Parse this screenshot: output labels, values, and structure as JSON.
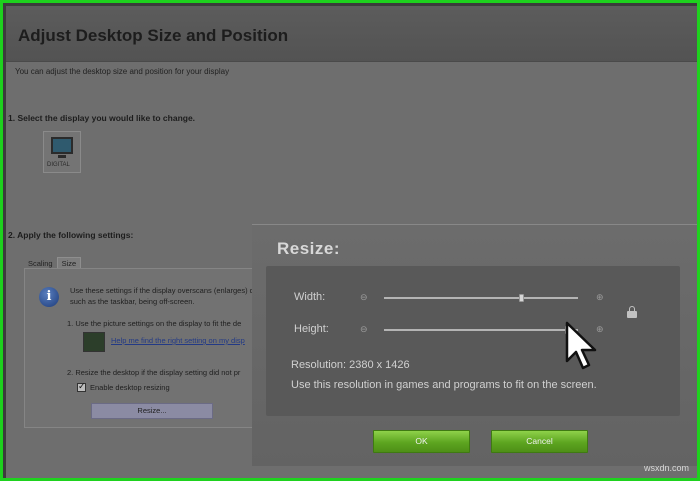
{
  "background_panel": {
    "title": "Adjust Desktop Size and Position",
    "subtitle": "You can adjust the desktop size and position for your display",
    "step1": "1. Select the display you would like to change.",
    "display_label": "DIGITAL",
    "step2": "2. Apply the following settings:",
    "tabs": [
      {
        "label": "Scaling",
        "active": false
      },
      {
        "label": "Size",
        "active": true
      }
    ],
    "info_text": "Use these settings if the display overscans (enlarges) desktop, such as the taskbar, being off-screen.",
    "substep1": "1. Use the picture settings on the display to fit the de",
    "help_link": "Help me find the right setting on my disp",
    "substep2": "2. Resize the desktop if the display setting did not pr",
    "enable_checkbox_label": "Enable desktop resizing",
    "enable_checked": true,
    "resize_button": "Resize..."
  },
  "dialog": {
    "title": "Resize:",
    "width_label": "Width:",
    "height_label": "Height:",
    "width_level": 0.71,
    "height_level": 0.95,
    "resolution": "Resolution: 2380 x 1426",
    "note": "Use this resolution in games and programs to fit on the screen.",
    "ok_label": "OK",
    "cancel_label": "Cancel"
  },
  "watermark": "wsxdn.com",
  "colors": {
    "frame_border": "#1ed21e",
    "button_green": "#5da520",
    "link_blue": "#233a86"
  },
  "icons": {
    "info": "info-icon",
    "lock": "lock-icon",
    "cursor": "mouse-cursor-icon",
    "monitor": "monitor-icon"
  }
}
